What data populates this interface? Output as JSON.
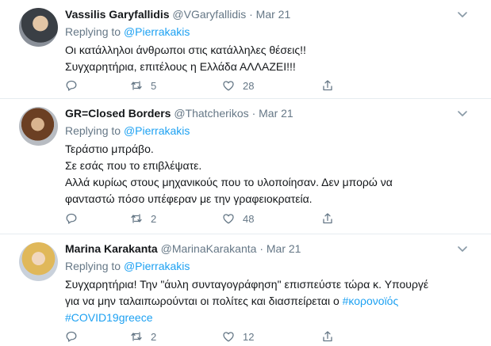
{
  "tweets": [
    {
      "name": "Vassilis Garyfallidis",
      "handle": "@VGaryfallidis",
      "separator": "·",
      "date": "Mar 21",
      "replying_label": "Replying to",
      "replying_to": "@Pierrakakis",
      "lines": [
        "Οι κατάλληλοι άνθρωποι στις κατάλληλες θέσεις!!",
        "Συγχαρητήρια, επιτέλους η Ελλάδα ΑΛΛΑΖΕΙ!!!"
      ],
      "reply_count": "",
      "retweet_count": "5",
      "like_count": "28"
    },
    {
      "name": "GR=Closed Borders",
      "handle": "@Thatcherikos",
      "separator": "·",
      "date": "Mar 21",
      "replying_label": "Replying to",
      "replying_to": "@Pierrakakis",
      "lines": [
        "Τεράστιο μπράβο.",
        "Σε εσάς που το επιβλέψατε.",
        "Αλλά κυρίως στους μηχανικούς που το υλοποίησαν. Δεν μπορώ να",
        "φανταστώ πόσο υπέφεραν με την γραφειοκρατεία."
      ],
      "reply_count": "",
      "retweet_count": "2",
      "like_count": "48"
    },
    {
      "name": "Marina Karakanta",
      "handle": "@MarinaKarakanta",
      "separator": "·",
      "date": "Mar 21",
      "replying_label": "Replying to",
      "replying_to": "@Pierrakakis",
      "line1": "Συγχαρητήρια! Την \"άυλη συνταγογράφηση\" επισπεύστε τώρα κ. Υπουργέ",
      "line2_text": "για να μην ταλαιπωρούνται οι πολίτες και διασπείρεται ο ",
      "line2_tag": "#κορονοϊός",
      "line3_tag": "#COVID19greece",
      "reply_count": "",
      "retweet_count": "2",
      "like_count": "12"
    }
  ],
  "icons": {
    "reply": "reply-icon",
    "retweet": "retweet-icon",
    "like": "heart-icon",
    "share": "share-icon",
    "more": "chevron-down-icon"
  },
  "colors": {
    "link": "#1da1f2",
    "secondary": "#657786",
    "text": "#14171a",
    "divider": "#e6ecf0"
  }
}
